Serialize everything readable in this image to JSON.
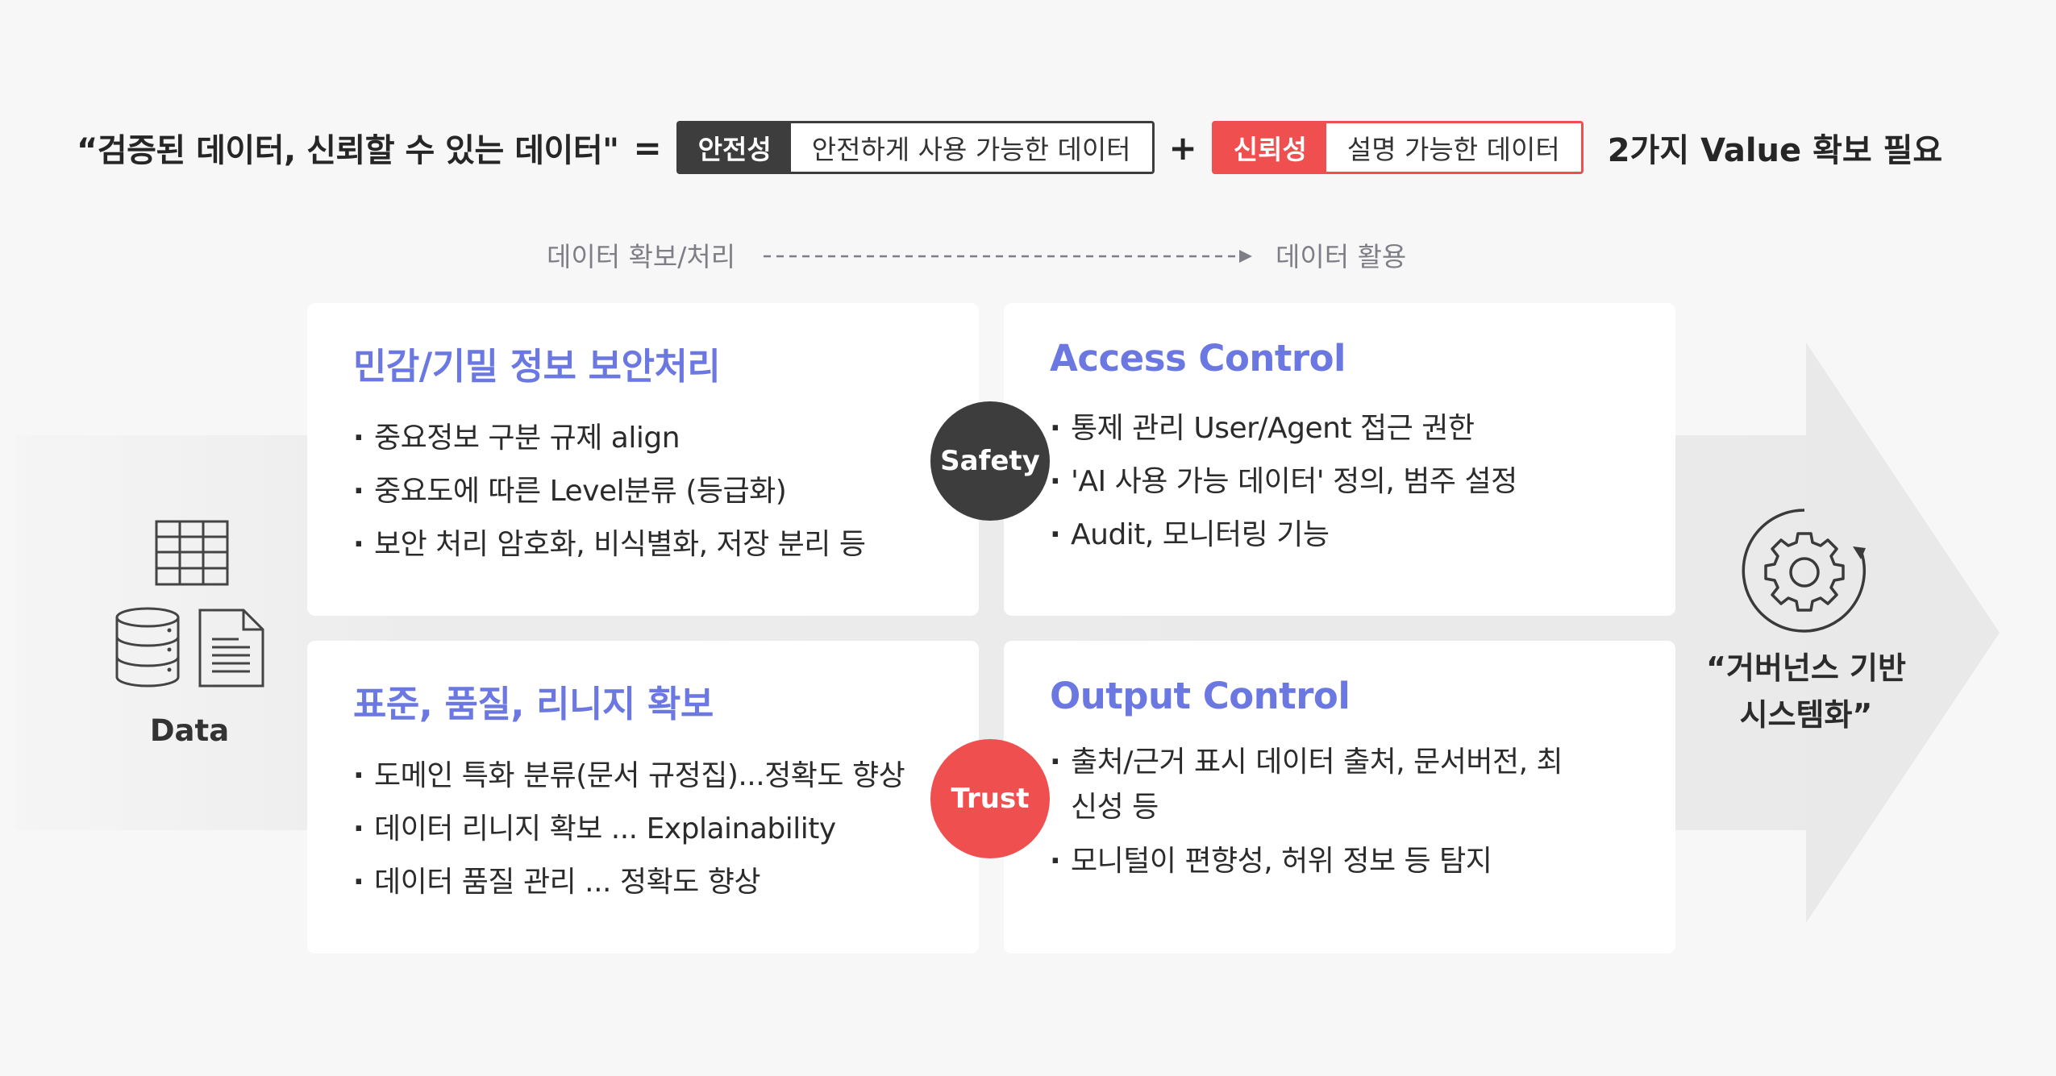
{
  "headline": {
    "quote": "“검증된 데이터, 신뢰할 수 있는 데이터\"",
    "equals": "=",
    "safety_tag": "안전성",
    "safety_desc": "안전하게 사용 가능한 데이터",
    "plus": "+",
    "trust_tag": "신뢰성",
    "trust_desc": "설명 가능한 데이터",
    "need": "2가지 Value 확보 필요"
  },
  "flow": {
    "from": "데이터 확보/처리",
    "to": "데이터 활용"
  },
  "cards": {
    "top_left": {
      "title": "민감/기밀 정보 보안처리",
      "items": [
        "중요정보 구분 규제 align",
        "중요도에 따른 Level분류 (등급화)",
        "보안 처리 암호화, 비식별화, 저장 분리 등"
      ]
    },
    "top_right": {
      "title": "Access Control",
      "items": [
        "통제 관리 User/Agent 접근 권한",
        "'AI 사용 가능 데이터' 정의, 범주 설정",
        "Audit, 모니터링 기능"
      ]
    },
    "bottom_left": {
      "title": "표준, 품질, 리니지 확보",
      "items": [
        "도메인 특화 분류(문서 규정집)...정확도 향상",
        "데이터 리니지 확보 ... Explainability",
        "데이터 품질 관리 ... 정확도 향상"
      ]
    },
    "bottom_right": {
      "title": "Output Control",
      "items": [
        "출처/근거 표시 데이터 출처, 문서버전, 최신성 등",
        "모니털이 편향성, 허위 정보 등 탐지"
      ]
    }
  },
  "badges": {
    "safety": "Safety",
    "trust": "Trust"
  },
  "data_label": "Data",
  "result": {
    "line1": "“거버넌스 기반",
    "line2": "시스템화”"
  },
  "icons": [
    "table-grid-icon",
    "database-icon",
    "document-icon",
    "gear-cycle-icon",
    "arrow-right-icon"
  ],
  "colors": {
    "accent_title": "#6b78e2",
    "safety": "#3d3d3d",
    "trust": "#ef4f4f",
    "background": "#f7f7f7",
    "big_arrow": "#ebebeb"
  }
}
